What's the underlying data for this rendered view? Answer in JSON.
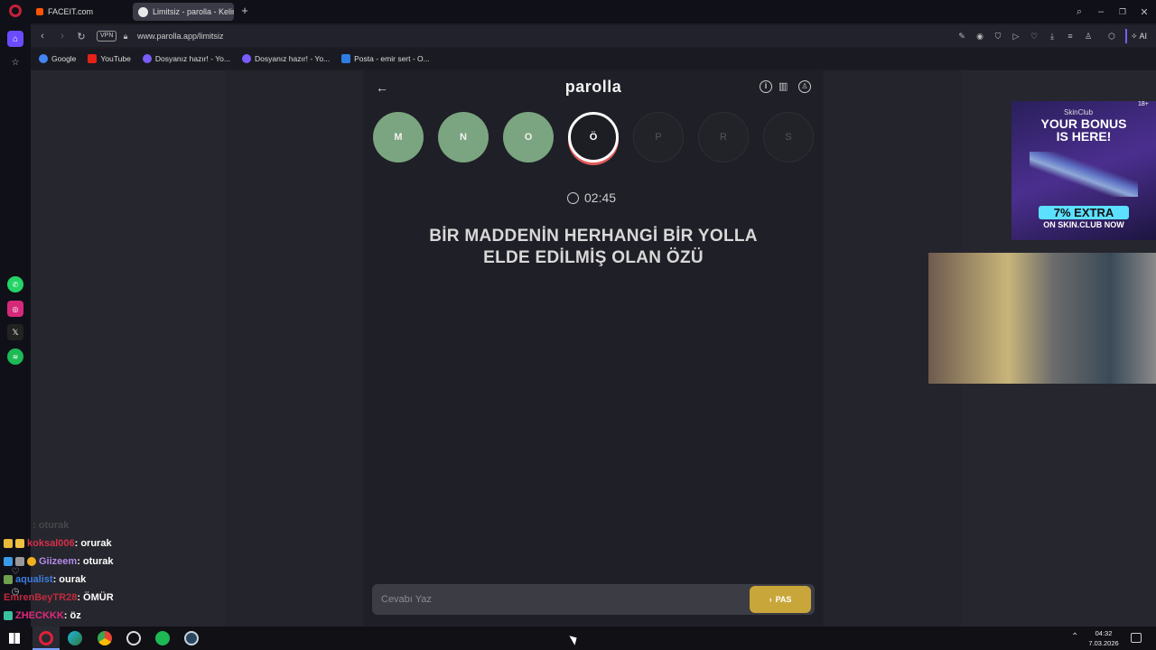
{
  "browser": {
    "tabs": [
      {
        "label": "FACEIT.com",
        "active": false
      },
      {
        "label": "Limitsiz - parolla - Kelime",
        "active": true
      }
    ],
    "new_tab": "+",
    "vpn_badge": "VPN",
    "url": "www.parolla.app/limitsiz",
    "ai_label": "AI",
    "bookmarks": [
      {
        "label": "Google",
        "color": "#4285f4"
      },
      {
        "label": "YouTube",
        "color": "#e62117"
      },
      {
        "label": "Dosyanız hazır! - Yo...",
        "color": "#7a5cff"
      },
      {
        "label": "Dosyanız hazır! - Yo...",
        "color": "#7a5cff"
      },
      {
        "label": "Posta - emir sert - O...",
        "color": "#2f7de1"
      }
    ]
  },
  "app": {
    "title": "parolla",
    "back_icon": "arrow-left-icon",
    "letters": [
      {
        "char": "M",
        "state": "done"
      },
      {
        "char": "N",
        "state": "done"
      },
      {
        "char": "O",
        "state": "done"
      },
      {
        "char": "Ö",
        "state": "current"
      },
      {
        "char": "P",
        "state": "pending"
      },
      {
        "char": "R",
        "state": "pending"
      },
      {
        "char": "S",
        "state": "pending"
      }
    ],
    "timer": "02:45",
    "question_line1": "BİR MADDENİN HERHANGİ BİR YOLLA",
    "question_line2": "ELDE EDİLMİŞ OLAN ÖZÜ",
    "answer_placeholder": "Cevabı Yaz",
    "pass_label": "PAS",
    "colors": {
      "done": "#7aa580",
      "pass": "#c9a63a",
      "current_ring": "#e05a5a"
    }
  },
  "ad": {
    "brand": "SkinClub",
    "headline1": "YOUR BONUS",
    "headline2": "IS HERE!",
    "offer": "7% EXTRA",
    "cta": "ON SKIN.CLUB NOW",
    "age": "18+"
  },
  "chat": [
    {
      "user": "",
      "msg": ": oturak",
      "color": "#555",
      "faded": true
    },
    {
      "user": "koksal006",
      "msg": " : orurak",
      "color": "#d6304a"
    },
    {
      "user": "Giizeem",
      "msg": " : oturak",
      "color": "#b48ae8"
    },
    {
      "user": "aqualist",
      "msg": " : ourak",
      "color": "#3b7de0"
    },
    {
      "user": "EmrenBeyTR28",
      "msg": " : ÖMÜR",
      "color": "#c02b3c"
    },
    {
      "user": "ZHECKKK",
      "msg": " : öz",
      "color": "#e02a7a"
    }
  ],
  "taskbar": {
    "time": "04:32",
    "date": "7.03.2026"
  }
}
